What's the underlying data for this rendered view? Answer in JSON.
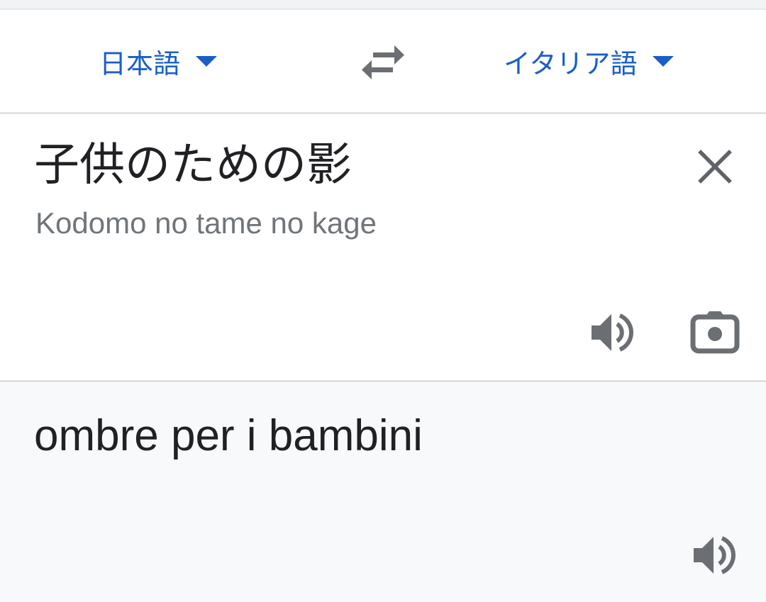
{
  "language_bar": {
    "source_language": "日本語",
    "target_language": "イタリア語"
  },
  "input": {
    "source_text": "子供のための影",
    "romanization": "Kodomo no tame no kage"
  },
  "output": {
    "translation": "ombre per i bambini"
  },
  "icons": {
    "swap": "swap-arrows-icon",
    "clear": "close-icon",
    "source_speaker": "speaker-icon",
    "camera": "camera-icon",
    "target_speaker": "speaker-icon"
  },
  "colors": {
    "accent": "#1a5fc8",
    "icon_gray": "#6b6e72",
    "text_primary": "#202124",
    "text_secondary": "#70757a",
    "output_background": "#f8f9fa"
  }
}
